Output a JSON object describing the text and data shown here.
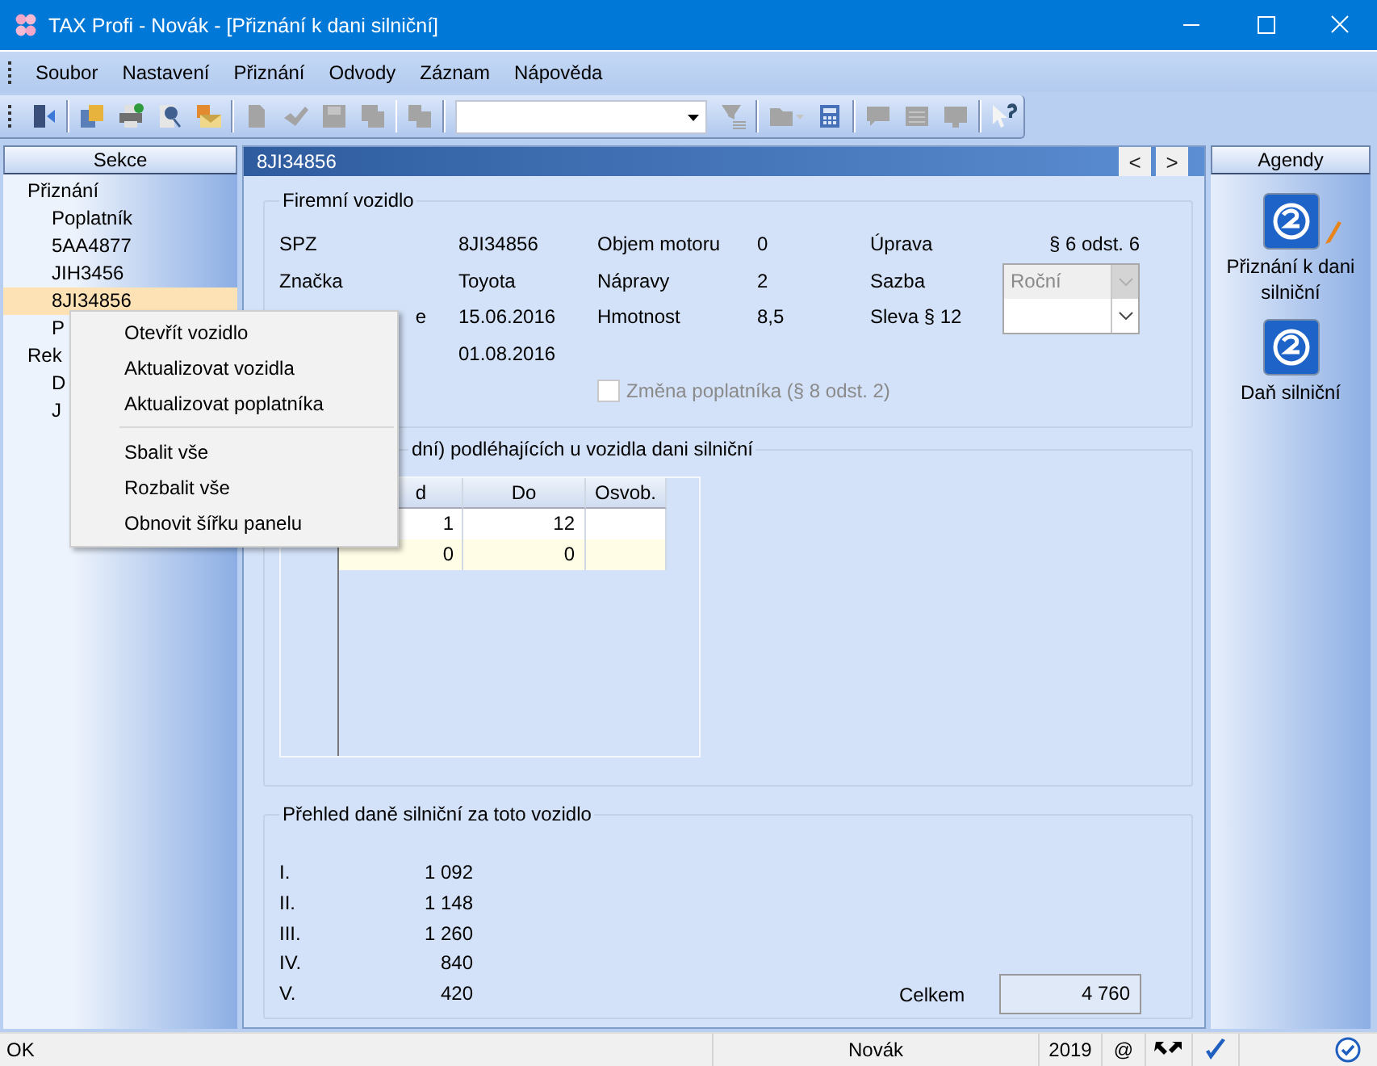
{
  "window": {
    "title": "TAX Profi - Novák - [Přiznání k dani silniční]"
  },
  "menu": [
    "Soubor",
    "Nastavení",
    "Přiznání",
    "Odvody",
    "Záznam",
    "Nápověda"
  ],
  "toolbar": {
    "groups": [
      [
        {
          "disabled": false
        }
      ],
      [
        {
          "disabled": false
        },
        {
          "disabled": false
        },
        {
          "disabled": false
        },
        {
          "disabled": false
        }
      ],
      [
        {
          "disabled": true
        },
        {
          "disabled": true
        },
        {
          "disabled": true
        },
        {
          "disabled": true
        }
      ],
      [
        {
          "disabled": true
        }
      ],
      [
        {
          "disabled": true
        }
      ],
      [
        {
          "disabled": true
        },
        {
          "disabled": false
        }
      ],
      [
        {
          "disabled": true
        },
        {
          "disabled": true
        },
        {
          "disabled": true
        }
      ],
      [
        {
          "disabled": false
        }
      ]
    ]
  },
  "sidebar": {
    "title": "Sekce",
    "items": [
      {
        "label": "Přiznání",
        "selected": false,
        "children": [
          {
            "label": "Poplatník",
            "selected": false
          },
          {
            "label": "5AA4877",
            "selected": false
          },
          {
            "label": "JIH3456",
            "selected": false
          },
          {
            "label": "8JI34856",
            "selected": true
          },
          {
            "label": "P",
            "selected": false
          }
        ]
      },
      {
        "label": "Rek",
        "selected": false,
        "children": [
          {
            "label": "D",
            "selected": false
          },
          {
            "label": "J",
            "selected": false
          }
        ]
      }
    ]
  },
  "context_menu": {
    "groups": [
      [
        "Otevřít vozidlo",
        "Aktualizovat vozidla",
        "Aktualizovat poplatníka"
      ],
      [
        "Sbalit vše",
        "Rozbalit vše",
        "Obnovit šířku panelu"
      ]
    ]
  },
  "panel": {
    "title": "8JI34856",
    "nav": [
      "<",
      ">"
    ],
    "vehicle": {
      "legend": "Firemní vozidlo",
      "rows": [
        [
          {
            "label": "SPZ",
            "value": "8JI34856"
          },
          {
            "label": "Objem motoru",
            "value": "0"
          },
          {
            "label": "Úprava",
            "value": "§ 6 odst. 6"
          }
        ],
        [
          {
            "label": "Značka",
            "value": "Toyota"
          },
          {
            "label": "Nápravy",
            "value": "2"
          },
          {
            "label": "Sazba",
            "combo": "Roční",
            "disabled": true
          }
        ],
        [
          {
            "label": "e",
            "value": "15.06.2016"
          },
          {
            "label": "Hmotnost",
            "value": "8,5"
          },
          {
            "label": "Sleva § 12",
            "disabled": false
          }
        ],
        [
          {
            "value": "01.08.2016"
          }
        ]
      ],
      "checkbox": {
        "label": "Změna poplatníka (§ 8 odst. 2)",
        "checked": false,
        "disabled": true
      }
    },
    "months": {
      "legend": "dní) podléhajících u vozidla dani silniční",
      "columns": [
        "d",
        "Do",
        "Osvob."
      ],
      "rows": [
        {
          "cells": [
            "1",
            "12",
            ""
          ],
          "new": false
        },
        {
          "cells": [
            "0",
            "0",
            ""
          ],
          "new": true
        }
      ]
    },
    "overview": {
      "legend": "Přehled daně silniční za toto vozidlo",
      "rows": [
        {
          "label": "I.",
          "value": "1 092"
        },
        {
          "label": "II.",
          "value": "1 148"
        },
        {
          "label": "III.",
          "value": "1 260"
        },
        {
          "label": "IV.",
          "value": "840"
        },
        {
          "label": "V.",
          "value": "420"
        }
      ],
      "total_label": "Celkem",
      "total": "4 760"
    }
  },
  "agendy": {
    "title": "Agendy",
    "items": [
      {
        "label": "Přiznání k dani silniční",
        "editing": true
      },
      {
        "label": "Daň silniční",
        "editing": false
      }
    ]
  },
  "status_bar": {
    "message": "OK",
    "user": "Novák",
    "year": "2019",
    "at": "@"
  }
}
